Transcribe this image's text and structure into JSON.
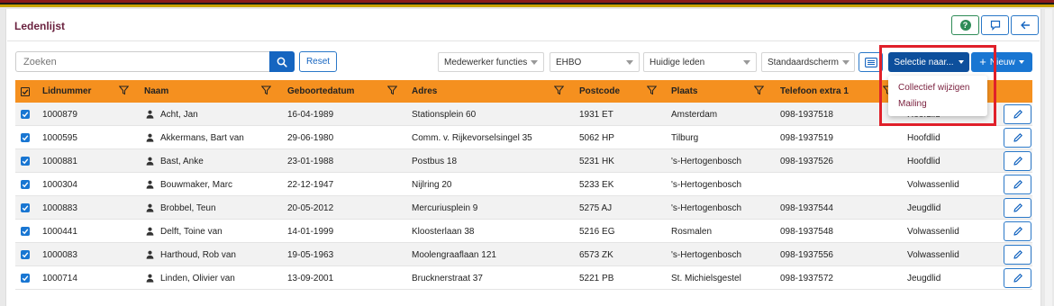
{
  "page": {
    "title": "Ledenlijst"
  },
  "toolbar": {
    "search_placeholder": "Zoeken",
    "reset_label": "Reset",
    "filters": [
      {
        "value": "Medewerker functies"
      },
      {
        "value": "EHBO"
      },
      {
        "value": "Huidige leden"
      },
      {
        "value": "Standaardscherm"
      }
    ],
    "selectie_label": "Selectie naar...",
    "nieuw_label": "Nieuw"
  },
  "dropdown": {
    "items": [
      "Collectief wijzigen",
      "Mailing"
    ]
  },
  "table": {
    "columns": [
      "Lidnummer",
      "Naam",
      "Geboortedatum",
      "Adres",
      "Postcode",
      "Plaats",
      "Telefoon extra 1",
      ""
    ],
    "rows": [
      {
        "lidnummer": "1000879",
        "naam": "Acht, Jan",
        "geboortedatum": "16-04-1989",
        "adres": "Stationsplein 60",
        "postcode": "1931 ET",
        "plaats": "Amsterdam",
        "telefoon": "098-1937518",
        "type": "Hoofdlid"
      },
      {
        "lidnummer": "1000595",
        "naam": "Akkermans, Bart van",
        "geboortedatum": "29-06-1980",
        "adres": "Comm. v. Rijkevorselsingel 35",
        "postcode": "5062 HP",
        "plaats": "Tilburg",
        "telefoon": "098-1937519",
        "type": "Hoofdlid"
      },
      {
        "lidnummer": "1000881",
        "naam": "Bast, Anke",
        "geboortedatum": "23-01-1988",
        "adres": "Postbus 18",
        "postcode": "5231 HK",
        "plaats": "'s-Hertogenbosch",
        "telefoon": "098-1937526",
        "type": "Hoofdlid"
      },
      {
        "lidnummer": "1000304",
        "naam": "Bouwmaker, Marc",
        "geboortedatum": "22-12-1947",
        "adres": "Nijlring 20",
        "postcode": "5233 EK",
        "plaats": "'s-Hertogenbosch",
        "telefoon": "",
        "type": "Volwassenlid"
      },
      {
        "lidnummer": "1000883",
        "naam": "Brobbel, Teun",
        "geboortedatum": "20-05-2012",
        "adres": "Mercuriusplein 9",
        "postcode": "5275 AJ",
        "plaats": "'s-Hertogenbosch",
        "telefoon": "098-1937544",
        "type": "Jeugdlid"
      },
      {
        "lidnummer": "1000441",
        "naam": "Delft, Toine van",
        "geboortedatum": "14-01-1999",
        "adres": "Kloosterlaan 38",
        "postcode": "5216 EG",
        "plaats": "Rosmalen",
        "telefoon": "098-1937548",
        "type": "Volwassenlid"
      },
      {
        "lidnummer": "1000083",
        "naam": "Harthoud, Rob van",
        "geboortedatum": "19-05-1963",
        "adres": "Moolengraaflaan 121",
        "postcode": "6573 ZK",
        "plaats": "'s-Hertogenbosch",
        "telefoon": "098-1937556",
        "type": "Volwassenlid"
      },
      {
        "lidnummer": "1000714",
        "naam": "Linden, Olivier van",
        "geboortedatum": "13-09-2001",
        "adres": "Brucknerstraat 37",
        "postcode": "5221 PB",
        "plaats": "St. Michielsgestel",
        "telefoon": "098-1937572",
        "type": "Jeugdlid"
      }
    ]
  },
  "colors": {
    "header_orange": "#f5901f",
    "primary_blue": "#1976d2",
    "title_maroon": "#6b2340",
    "highlight_red": "#e0202a"
  },
  "icons": [
    "question-icon",
    "comment-icon",
    "arrow-left-icon",
    "search-icon",
    "list-icon",
    "plus-icon",
    "filter-icon",
    "person-icon",
    "pencil-icon",
    "checkbox-icon"
  ]
}
